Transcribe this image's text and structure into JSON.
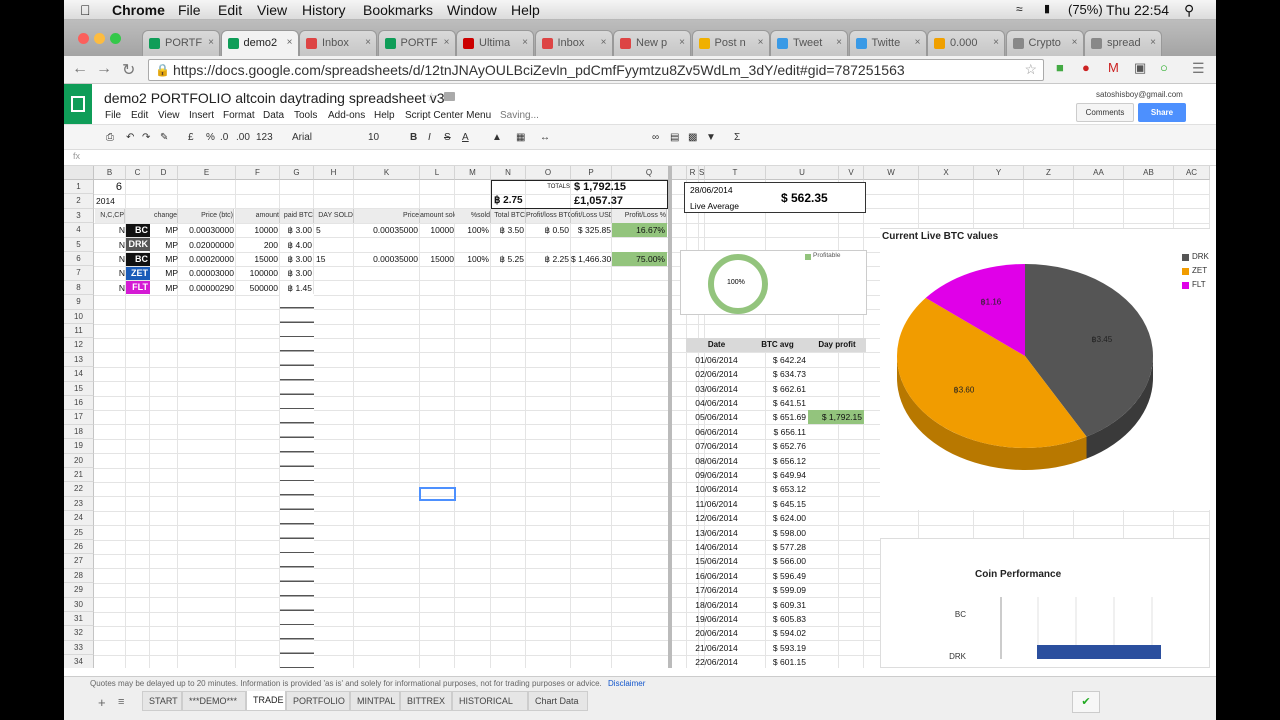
{
  "mac_menubar": {
    "items": [
      "Chrome",
      "File",
      "Edit",
      "View",
      "History",
      "Bookmarks",
      "Window",
      "Help"
    ],
    "battery": "(75%)",
    "clock": "Thu 22:54"
  },
  "browser": {
    "tabs": [
      {
        "label": "PORTF",
        "icon_color": "#0f9d58"
      },
      {
        "label": "demo2",
        "icon_color": "#0f9d58",
        "active": true
      },
      {
        "label": "Inbox",
        "icon_color": "#d44"
      },
      {
        "label": "PORTF",
        "icon_color": "#0f9d58"
      },
      {
        "label": "Ultima",
        "icon_color": "#c00"
      },
      {
        "label": "Inbox",
        "icon_color": "#d44"
      },
      {
        "label": "New p",
        "icon_color": "#d44"
      },
      {
        "label": "Post n",
        "icon_color": "#f0b000"
      },
      {
        "label": "Tweet",
        "icon_color": "#3a9ae6"
      },
      {
        "label": "Twitte",
        "icon_color": "#3a9ae6"
      },
      {
        "label": "0.000",
        "icon_color": "#f0a000"
      },
      {
        "label": "Crypto",
        "icon_color": "#888"
      },
      {
        "label": "spread",
        "icon_color": "#888"
      }
    ],
    "url": "https://docs.google.com/spreadsheets/d/12tnJNAyOULBciZevln_pdCmfFyymtzu8Zv5WdLm_3dY/edit#gid=787251563"
  },
  "doc": {
    "title": "demo2 PORTFOLIO altcoin daytrading spreadsheet v3",
    "menus": [
      "File",
      "Edit",
      "View",
      "Insert",
      "Format",
      "Data",
      "Tools",
      "Add-ons",
      "Help",
      "Script Center Menu"
    ],
    "saving": "Saving...",
    "user": "satoshisboy@gmail.com",
    "comments_label": "Comments",
    "share_label": "Share"
  },
  "format_bar": {
    "font": "Arial",
    "size": "10",
    "number": "123",
    "currency": "£",
    "percent": "%",
    "decimals": ".0",
    "decimals2": ".00",
    "fx": "fx"
  },
  "columns": [
    "B",
    "C",
    "D",
    "E",
    "F",
    "G",
    "H",
    "K",
    "L",
    "M",
    "N",
    "O",
    "P",
    "Q",
    "R",
    "S",
    "T",
    "U",
    "V",
    "W",
    "X",
    "Y",
    "Z",
    "AA",
    "AB",
    "AC"
  ],
  "sheet": {
    "b1": "6",
    "b2": "2014",
    "totals_label": "TOTALS",
    "total_usd": "$ 1,792.15",
    "total_btc": "฿ 2.75",
    "total_gbp": "£1,057.37",
    "headers": [
      "N,C,CP",
      "Coin",
      "change",
      "Price (btc)",
      "amount",
      "paid BTC",
      "DAY SOLD",
      "Price",
      "amount sold",
      "%sold",
      "Total BTC",
      "Profit/loss BTC",
      "ofit/Loss USD",
      "Profit/Loss %"
    ],
    "rows": [
      {
        "n": "N",
        "coin": "BC",
        "coin_bg": "#111",
        "ex": "MP",
        "price": "0.00030000",
        "amount": "10000",
        "paid": "฿ 3.00",
        "day": "5",
        "sprice": "0.00035000",
        "samt": "10000",
        "pct": "100%",
        "tbtc": "฿ 3.50",
        "pl": "฿ 0.50",
        "plusd": "$ 325.85",
        "plpct": "16.67%"
      },
      {
        "n": "N",
        "coin": "DRK",
        "coin_bg": "#555",
        "ex": "MP",
        "price": "0.02000000",
        "amount": "200",
        "paid": "฿ 4.00"
      },
      {
        "n": "N",
        "coin": "BC",
        "coin_bg": "#111",
        "ex": "MP",
        "price": "0.00020000",
        "amount": "15000",
        "paid": "฿ 3.00",
        "day": "15",
        "sprice": "0.00035000",
        "samt": "15000",
        "pct": "100%",
        "tbtc": "฿ 5.25",
        "pl": "฿ 2.25",
        "plusd": "$ 1,466.30",
        "plpct": "75.00%"
      },
      {
        "n": "N",
        "coin": "ZET",
        "coin_bg": "#1a5bb8",
        "ex": "MP",
        "price": "0.00003000",
        "amount": "100000",
        "paid": "฿ 3.00"
      },
      {
        "n": "N",
        "coin": "FLT",
        "coin_bg": "#d41ad4",
        "ex": "MP",
        "price": "0.00000290",
        "amount": "500000",
        "paid": "฿ 1.45"
      }
    ],
    "t_date": "28/06/2014",
    "live_avg_label": "Live Average",
    "live_avg": "$ 562.35",
    "donut": {
      "label": "100%",
      "legend": "Profitable",
      "color": "#93c47d"
    },
    "daily": {
      "headers": [
        "Date",
        "BTC avg",
        "Day profit"
      ],
      "rows": [
        [
          "01/06/2014",
          "$ 642.24",
          ""
        ],
        [
          "02/06/2014",
          "$ 634.73",
          ""
        ],
        [
          "03/06/2014",
          "$ 662.61",
          ""
        ],
        [
          "04/06/2014",
          "$ 641.51",
          ""
        ],
        [
          "05/06/2014",
          "$ 651.69",
          "$ 1,792.15"
        ],
        [
          "06/06/2014",
          "$ 656.11",
          ""
        ],
        [
          "07/06/2014",
          "$ 652.76",
          ""
        ],
        [
          "08/06/2014",
          "$ 656.12",
          ""
        ],
        [
          "09/06/2014",
          "$ 649.94",
          ""
        ],
        [
          "10/06/2014",
          "$ 653.12",
          ""
        ],
        [
          "11/06/2014",
          "$ 645.15",
          ""
        ],
        [
          "12/06/2014",
          "$ 624.00",
          ""
        ],
        [
          "13/06/2014",
          "$ 598.00",
          ""
        ],
        [
          "14/06/2014",
          "$ 577.28",
          ""
        ],
        [
          "15/06/2014",
          "$ 566.00",
          ""
        ],
        [
          "16/06/2014",
          "$ 596.49",
          ""
        ],
        [
          "17/06/2014",
          "$ 599.09",
          ""
        ],
        [
          "18/06/2014",
          "$ 609.31",
          ""
        ],
        [
          "19/06/2014",
          "$ 605.83",
          ""
        ],
        [
          "20/06/2014",
          "$ 594.02",
          ""
        ],
        [
          "21/06/2014",
          "$ 593.19",
          ""
        ],
        [
          "22/06/2014",
          "$ 601.15",
          ""
        ]
      ]
    }
  },
  "pie_chart": {
    "title": "Current Live BTC values",
    "slices": [
      {
        "name": "DRK",
        "value": 3.45,
        "label": "฿3.45",
        "color": "#555555",
        "side": "#3a3a3a"
      },
      {
        "name": "ZET",
        "value": 3.6,
        "label": "฿3.60",
        "color": "#f19c00",
        "side": "#b87800"
      },
      {
        "name": "FLT",
        "value": 1.16,
        "label": "฿1.16",
        "color": "#e000e8",
        "side": "#a000a8"
      }
    ],
    "legend": [
      "DRK",
      "ZET",
      "FLT"
    ]
  },
  "bar_chart": {
    "title": "Coin Performance",
    "categories": [
      "BC",
      "DRK"
    ],
    "bar_color": "#2b4f9e"
  },
  "footer": {
    "disclaimer": "Quotes may be delayed up to 20 minutes. Information is provided 'as is' and solely for informational purposes, not for trading purposes or advice.",
    "disclaimer_link": "Disclaimer",
    "sheet_tabs": [
      "START",
      "***DEMO***",
      "TRADE",
      "PORTFOLIO",
      "MINTPAL",
      "BITTREX",
      "HISTORICAL",
      "Chart Data"
    ],
    "active_tab": "TRADE"
  }
}
